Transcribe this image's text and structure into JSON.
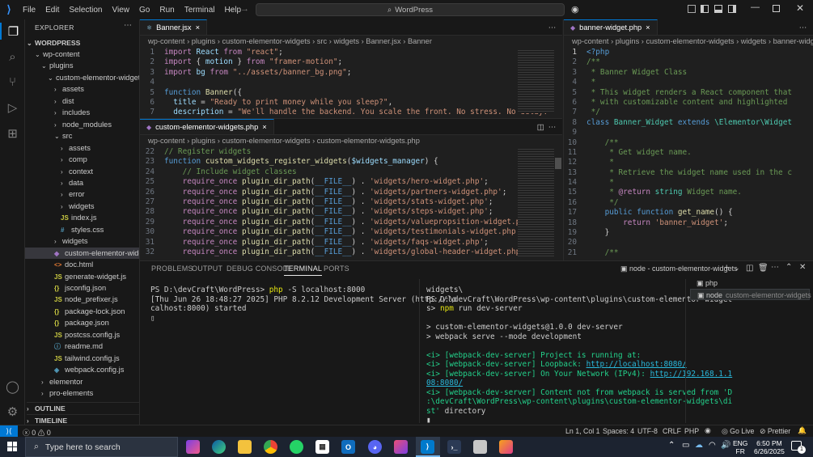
{
  "menu": [
    "File",
    "Edit",
    "Selection",
    "View",
    "Go",
    "Run",
    "Terminal",
    "Help"
  ],
  "search_text": "WordPress",
  "explorer": {
    "title": "EXPLORER",
    "root": "WORDPRESS",
    "items": [
      {
        "label": "wp-content",
        "kind": "folder-open",
        "depth": 0
      },
      {
        "label": "plugins",
        "kind": "folder-open",
        "depth": 1
      },
      {
        "label": "custom-elementor-widgets",
        "kind": "folder-open",
        "depth": 2
      },
      {
        "label": "assets",
        "kind": "folder",
        "depth": 3
      },
      {
        "label": "dist",
        "kind": "folder",
        "depth": 3
      },
      {
        "label": "includes",
        "kind": "folder",
        "depth": 3
      },
      {
        "label": "node_modules",
        "kind": "folder",
        "depth": 3
      },
      {
        "label": "src",
        "kind": "folder-open",
        "depth": 3
      },
      {
        "label": "assets",
        "kind": "folder",
        "depth": 4
      },
      {
        "label": "comp",
        "kind": "folder",
        "depth": 4
      },
      {
        "label": "context",
        "kind": "folder",
        "depth": 4
      },
      {
        "label": "data",
        "kind": "folder",
        "depth": 4
      },
      {
        "label": "error",
        "kind": "folder",
        "depth": 4
      },
      {
        "label": "widgets",
        "kind": "folder",
        "depth": 4
      },
      {
        "label": "index.js",
        "kind": "js",
        "depth": 4
      },
      {
        "label": "styles.css",
        "kind": "css",
        "depth": 4
      },
      {
        "label": "widgets",
        "kind": "folder",
        "depth": 3
      },
      {
        "label": "custom-elementor-widge...",
        "kind": "php",
        "depth": 3
      },
      {
        "label": "doc.html",
        "kind": "html",
        "depth": 3
      },
      {
        "label": "generate-widget.js",
        "kind": "js",
        "depth": 3
      },
      {
        "label": "jsconfig.json",
        "kind": "json",
        "depth": 3
      },
      {
        "label": "node_prefixer.js",
        "kind": "js",
        "depth": 3
      },
      {
        "label": "package-lock.json",
        "kind": "json",
        "depth": 3
      },
      {
        "label": "package.json",
        "kind": "json",
        "depth": 3
      },
      {
        "label": "postcss.config.js",
        "kind": "js",
        "depth": 3
      },
      {
        "label": "readme.md",
        "kind": "md",
        "depth": 3
      },
      {
        "label": "tailwind.config.js",
        "kind": "js",
        "depth": 3
      },
      {
        "label": "webpack.config.js",
        "kind": "webpack",
        "depth": 3
      },
      {
        "label": "elementor",
        "kind": "folder",
        "depth": 1
      },
      {
        "label": "pro-elements",
        "kind": "folder",
        "depth": 1
      }
    ],
    "outline": "OUTLINE",
    "timeline": "TIMELINE"
  },
  "editor1": {
    "tab": "Banner.jsx",
    "breadcrumb": [
      "wp-content",
      "plugins",
      "custom-elementor-widgets",
      "src",
      "widgets",
      "Banner.jsx",
      "Banner"
    ]
  },
  "editor2": {
    "tab": "custom-elementor-widgets.php",
    "breadcrumb": [
      "wp-content",
      "plugins",
      "custom-elementor-widgets",
      "custom-elementor-widgets.php"
    ]
  },
  "editor3": {
    "tab": "banner-widget.php",
    "breadcrumb": [
      "wp-content",
      "plugins",
      "custom-elementor-widgets",
      "widgets",
      "banner-widget.php"
    ]
  },
  "panel": {
    "tabs": [
      "PROBLEMS",
      "OUTPUT",
      "DEBUG CONSOLE",
      "TERMINAL",
      "PORTS"
    ],
    "active_tab": "TERMINAL",
    "terminal_title": "node - custom-elementor-widgets",
    "sessions": [
      {
        "icon": "php",
        "label": "php",
        "sub": ""
      },
      {
        "icon": "node",
        "label": "node",
        "sub": "custom-elementor-widgets"
      }
    ]
  },
  "status": {
    "errors": "0",
    "warnings": "0",
    "position": "Ln 1, Col 1",
    "spaces": "Spaces: 4",
    "encoding": "UTF-8",
    "eol": "CRLF",
    "language": "PHP",
    "golive": "Go Live",
    "prettier": "Prettier"
  },
  "taskbar": {
    "search_placeholder": "Type here to search",
    "lang": "ENG",
    "region": "FR",
    "time": "6:50 PM",
    "date": "6/26/2025",
    "notif_count": "1"
  }
}
